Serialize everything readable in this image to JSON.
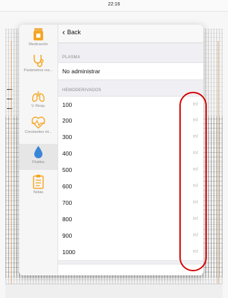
{
  "status_bar": {
    "time": "22:16"
  },
  "sidebar": {
    "items": [
      {
        "label": "Medicación",
        "icon": "medication-icon"
      },
      {
        "label": "Parámetros res...",
        "icon": "stethoscope-icon"
      },
      {
        "label": "V. Resp.",
        "icon": "lungs-icon"
      },
      {
        "label": "Constantes vit...",
        "icon": "heart-pulse-icon"
      },
      {
        "label": "Fluidos",
        "icon": "drop-icon",
        "active": true
      },
      {
        "label": "Notas",
        "icon": "clipboard-icon"
      }
    ]
  },
  "nav": {
    "back_label": "Back"
  },
  "plasma": {
    "header": "PLASMA",
    "option": "No administrar"
  },
  "hemoderivados": {
    "header": "HEMODERIVADOS",
    "unit": "ml",
    "rows": [
      "100",
      "200",
      "300",
      "400",
      "500",
      "600",
      "700",
      "800",
      "900",
      "1000"
    ]
  },
  "colors": {
    "annotation": "#d40000",
    "accent": "#3a86d6"
  }
}
